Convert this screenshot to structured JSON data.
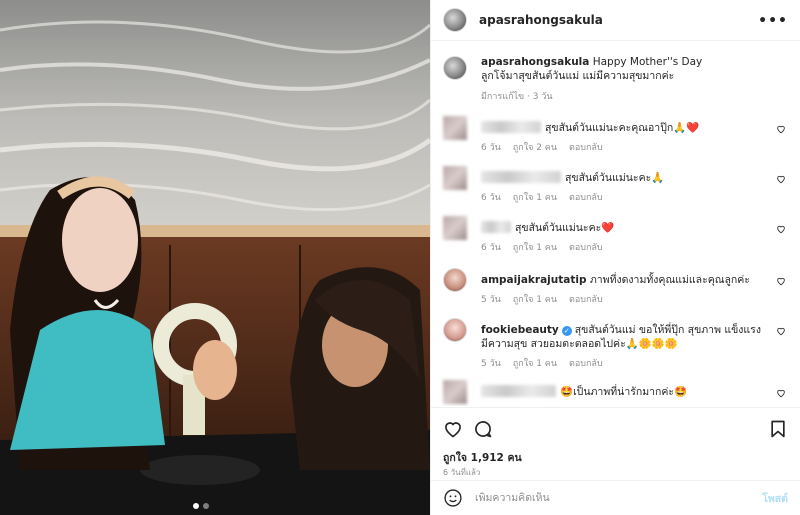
{
  "post": {
    "username": "apasrahongsakula",
    "caption_user": "apasrahongsakula",
    "caption_line1": "Happy Mother''s Day",
    "caption_line2": "ลูกโจ้มาสุขสันต์วันแม่ แม่มีความสุขมากค่ะ",
    "caption_meta": "มีการแก้ไข · 3 วัน"
  },
  "comments": [
    {
      "text": "สุขสันต์วันแม่นะคะคุณอาปุ๊ก🙏❤️",
      "time": "6 วัน",
      "likes": "ถูกใจ 2 คน",
      "reply": "ตอบกลับ",
      "blur_w": 60
    },
    {
      "text": "สุขสันต์วันแม่นะคะ🙏",
      "time": "6 วัน",
      "likes": "ถูกใจ 1 คน",
      "reply": "ตอบกลับ",
      "blur_w": 80
    },
    {
      "text": "สุขสันต์วันแม่นะคะ❤️",
      "time": "6 วัน",
      "likes": "ถูกใจ 1 คน",
      "reply": "ตอบกลับ",
      "blur_w": 30
    },
    {
      "user": "ampaijakrajutatip",
      "text": "ภาพที่งดงามทั้งคุณแม่และคุณลูกค่ะ",
      "time": "5 วัน",
      "likes": "ถูกใจ 1 คน",
      "reply": "ตอบกลับ"
    },
    {
      "user": "fookiebeauty",
      "text": "สุขสันต์วันแม่ ขอให้พี่ปุ๊ก สุขภาพ แข็งแรง มีความสุข สวยอมตะตลอดไปค่ะ🙏🌼🌼🌼",
      "time": "5 วัน",
      "likes": "ถูกใจ 1 คน",
      "reply": "ตอบกลับ"
    },
    {
      "text": "🤩เป็นภาพที่น่ารักมากค่ะ🤩",
      "blur_w": 75
    }
  ],
  "actions": {
    "likes_text": "ถูกใจ 1,912 คน",
    "date_text": "6 วันที่แล้ว"
  },
  "composer": {
    "placeholder": "เพิ่มความคิดเห็น",
    "post_label": "โพสต์"
  },
  "icons": {
    "more": "more-options-icon",
    "heart": "heart-icon",
    "comment": "comment-icon",
    "bookmark": "bookmark-icon",
    "emoji": "emoji-icon"
  },
  "colors": {
    "verified": "#3897f0",
    "post_disabled": "#b2dffc"
  }
}
